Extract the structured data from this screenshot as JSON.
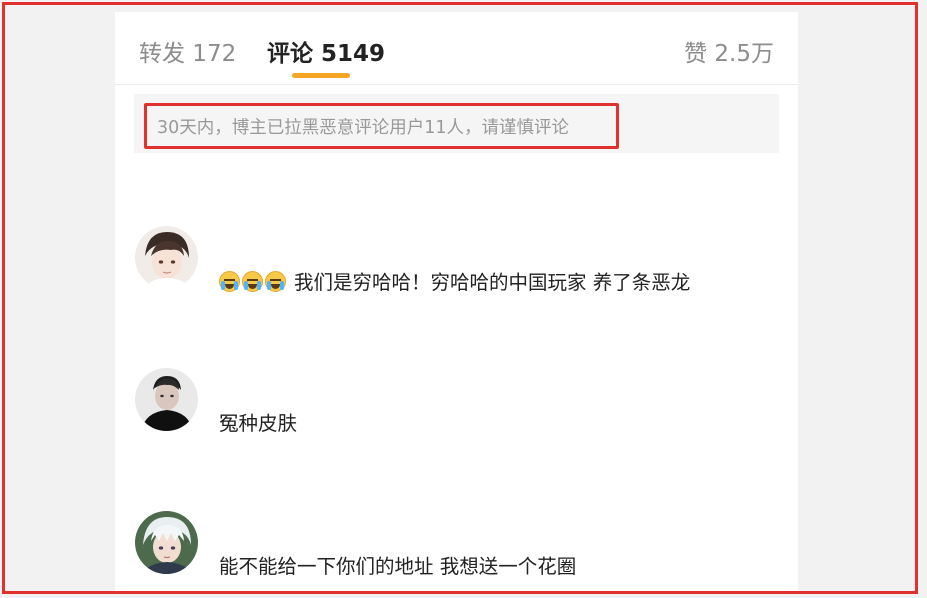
{
  "tabs": {
    "repost": "转发 172",
    "comments": "评论 5149",
    "likes": "赞 2.5万"
  },
  "notice": "30天内，博主已拉黑恶意评论用户11人，请谨慎评论",
  "comments": [
    {
      "emoji": "crying-laugh-emoji",
      "text": "我们是穷哈哈！穷哈哈的中国玩家 养了条恶龙"
    },
    {
      "text": "冤种皮肤"
    },
    {
      "text": "能不能给一下你们的地址  我想送一个花圈"
    }
  ],
  "colors": {
    "accent_underline": "#f5a623",
    "highlight_border": "#e0312f"
  }
}
